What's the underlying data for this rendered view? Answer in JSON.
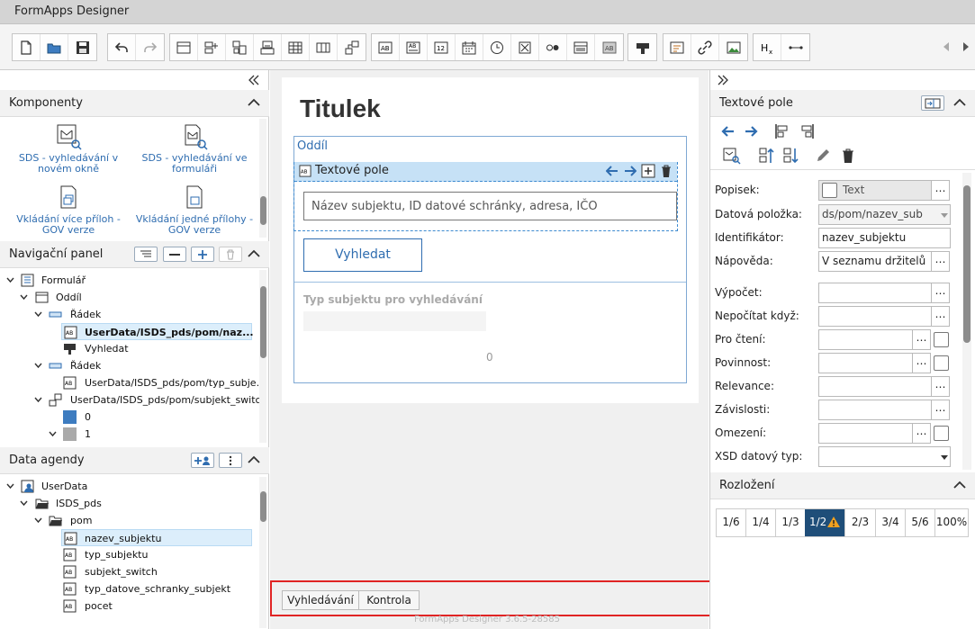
{
  "window": {
    "title": "FormApps Designer"
  },
  "footer": {
    "version": "FormApps Designer 3.6.5-28585"
  },
  "toolbar": {
    "groups": [
      [
        "new-file-icon",
        "open-folder-icon",
        "save-icon"
      ],
      [
        "undo-icon",
        "redo-icon"
      ],
      [
        "section-icon",
        "add-row-icon",
        "group-icon",
        "repeat-icon",
        "table-icon",
        "columns-icon",
        "switch-icon"
      ],
      [
        "text-field-icon",
        "text-area-icon",
        "number-field-icon",
        "date-icon",
        "time-icon",
        "checkbox-icon",
        "radio-icon",
        "select-icon",
        "label-icon"
      ],
      [
        "stamp-icon"
      ],
      [
        "html-icon",
        "link-icon",
        "image-icon"
      ],
      [
        "subscript-icon",
        "separator-icon"
      ]
    ]
  },
  "left": {
    "components": {
      "title": "Komponenty",
      "items": [
        {
          "label": "SDS - vyhledávání v novém okně"
        },
        {
          "label": "SDS - vyhledávání ve formuláři"
        },
        {
          "label": "Vkládání více příloh - GOV verze"
        },
        {
          "label": "Vkládání jedné přílohy - GOV verze"
        }
      ]
    },
    "nav": {
      "title": "Navigační panel",
      "items": [
        {
          "label": "Formulář",
          "icon": "form-icon"
        },
        {
          "label": "Oddíl",
          "icon": "section-icon"
        },
        {
          "label": "Řádek",
          "icon": "row-icon"
        },
        {
          "label": "UserData/ISDS_pds/pom/naz...",
          "icon": "text-field-icon",
          "selected": true
        },
        {
          "label": "Vyhledat",
          "icon": "button-icon"
        },
        {
          "label": "Řádek",
          "icon": "row-icon"
        },
        {
          "label": "UserData/ISDS_pds/pom/typ_subje...",
          "icon": "text-field-icon"
        },
        {
          "label": "UserData/ISDS_pds/pom/subjekt_switch",
          "icon": "switch-icon"
        },
        {
          "label": "0",
          "icon": "case-icon"
        },
        {
          "label": "1",
          "icon": "case-icon"
        }
      ]
    },
    "data": {
      "title": "Data agendy",
      "items": [
        {
          "label": "UserData",
          "icon": "data-root-icon"
        },
        {
          "label": "ISDS_pds",
          "icon": "folder-icon"
        },
        {
          "label": "pom",
          "icon": "folder-icon"
        },
        {
          "label": "nazev_subjektu",
          "icon": "text-field-icon",
          "selected": true
        },
        {
          "label": "typ_subjektu",
          "icon": "text-field-icon"
        },
        {
          "label": "subjekt_switch",
          "icon": "text-field-icon"
        },
        {
          "label": "typ_datove_schranky_subjekt",
          "icon": "text-field-icon"
        },
        {
          "label": "pocet",
          "icon": "text-field-icon"
        }
      ]
    }
  },
  "canvas": {
    "title": "Titulek",
    "section_label": "Oddíl",
    "textfield_label": "Textové pole",
    "input_placeholder": "Název subjektu, ID datové schránky, adresa, IČO",
    "search_button": "Vyhledat",
    "type_label": "Typ subjektu pro vyhledávání",
    "zero": "0"
  },
  "bottom_tabs": [
    "Vyhledávání",
    "Kontrola"
  ],
  "right": {
    "title": "Textové pole",
    "props": [
      {
        "label": "Popisek:",
        "value": "Text"
      },
      {
        "label": "Datová položka:",
        "value": "ds/pom/nazev_sub"
      },
      {
        "label": "Identifikátor:",
        "value": "nazev_subjektu"
      },
      {
        "label": "Nápověda:",
        "value": "V seznamu držitelů"
      },
      {
        "label": "Výpočet:",
        "value": ""
      },
      {
        "label": "Nepočítat když:",
        "value": ""
      },
      {
        "label": "Pro čtení:",
        "value": ""
      },
      {
        "label": "Povinnost:",
        "value": ""
      },
      {
        "label": "Relevance:",
        "value": ""
      },
      {
        "label": "Závislosti:",
        "value": ""
      },
      {
        "label": "Omezení:",
        "value": ""
      },
      {
        "label": "XSD datový typ:",
        "value": ""
      }
    ],
    "layout": {
      "title": "Rozložení",
      "ratios": [
        "1/6",
        "1/4",
        "1/3",
        "1/2",
        "2/3",
        "3/4",
        "5/6",
        "100%"
      ],
      "selected": "1/2"
    }
  },
  "colors": {
    "accent": "#2f6db0",
    "selected_ratio": "#1f4e79",
    "highlight": "#e02424"
  }
}
